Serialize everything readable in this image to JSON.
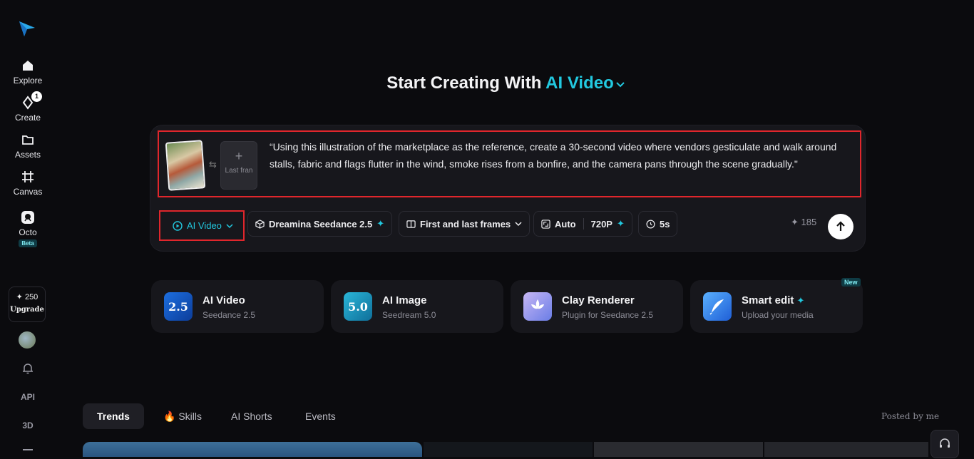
{
  "sidebar": {
    "items": [
      {
        "label": "Explore",
        "icon": "home-icon"
      },
      {
        "label": "Create",
        "icon": "create-icon",
        "badge": "1"
      },
      {
        "label": "Assets",
        "icon": "folder-icon"
      },
      {
        "label": "Canvas",
        "icon": "canvas-icon"
      },
      {
        "label": "Octo",
        "icon": "octo-icon",
        "tag": "Beta"
      }
    ],
    "credits": "✦ 250",
    "upgrade_label": "Upgrade",
    "api_label": "API",
    "threed_label": "3D"
  },
  "hero": {
    "title_prefix": "Start Creating With",
    "title_accent": "AI Video"
  },
  "composer": {
    "last_frame_label": "Last fran",
    "prompt": "“Using this illustration of the marketplace as the reference, create a 30-second video where vendors gesticulate and walk around stalls, fabric and flags flutter in the wind, smoke rises from a bonfire, and the camera pans through the scene gradually.\"",
    "mode_label": "AI Video",
    "model_label": "Dreamina Seedance 2.5",
    "frames_label": "First and last frames",
    "ratio_label": "Auto",
    "resolution_label": "720P",
    "duration_label": "5s",
    "cost": "185"
  },
  "cards": [
    {
      "title": "AI Video",
      "subtitle": "Seedance 2.5",
      "icon_text": "2.5"
    },
    {
      "title": "AI Image",
      "subtitle": "Seedream 5.0",
      "icon_text": "5.0"
    },
    {
      "title": "Clay Renderer",
      "subtitle": "Plugin for Seedance 2.5"
    },
    {
      "title": "Smart edit",
      "subtitle": "Upload your media",
      "badge": "New"
    }
  ],
  "tabs": [
    {
      "label": "Trends"
    },
    {
      "label": "Skills"
    },
    {
      "label": "AI Shorts"
    },
    {
      "label": "Events"
    }
  ],
  "posted_by": "Posted by me",
  "colors": {
    "accent": "#22c9e0",
    "highlight_border": "#e0262c"
  }
}
